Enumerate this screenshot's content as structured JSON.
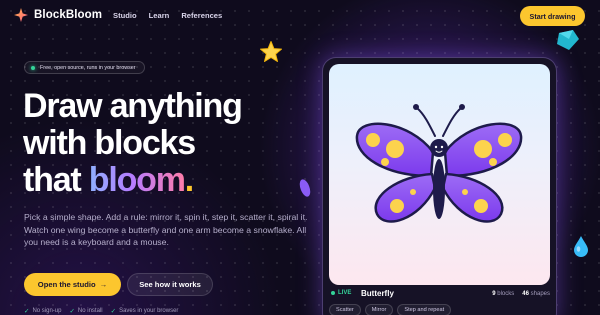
{
  "nav": {
    "brand": "BlockBloom",
    "links": [
      "Studio",
      "Learn",
      "References"
    ],
    "cta": "Start drawing"
  },
  "hero": {
    "badge": "Free, open source, runs in your browser",
    "headline_line1": "Draw anything",
    "headline_line2": "with blocks",
    "headline_line3_prefix": "that ",
    "headline_line3_accent": "bloom",
    "headline_line3_suffix": ".",
    "description": "Pick a simple shape. Add a rule: mirror it, spin it, step it, scatter it, spiral it. Watch one wing become a butterfly and one arm become a snowflake. All you need is a keyboard and a mouse.",
    "primary_button": "Open the studio",
    "primary_button_arrow": "→",
    "secondary_button": "See how it works",
    "features": [
      "No sign-up",
      "No install",
      "Saves in your browser"
    ],
    "feature_check": "✓"
  },
  "card": {
    "live_label": "LIVE",
    "title": "Butterfly",
    "blocks_count": "9",
    "blocks_label": "blocks",
    "shapes_count": "46",
    "shapes_label": "shapes",
    "rules": [
      "Scatter",
      "Mirror",
      "Step and repeat"
    ]
  },
  "colors": {
    "background": "#0f0b1d",
    "accent_yellow": "#fcc62e",
    "live_green": "#34d399",
    "butterfly_wing": "#8b5cf6",
    "butterfly_spots": "#fcd34d",
    "butterfly_body": "#1e1b4b"
  },
  "icons": {
    "logo": "four-point-sparkle-icon",
    "decor": [
      "star-icon",
      "gem-icon",
      "petal-icon",
      "drop-icon"
    ]
  }
}
